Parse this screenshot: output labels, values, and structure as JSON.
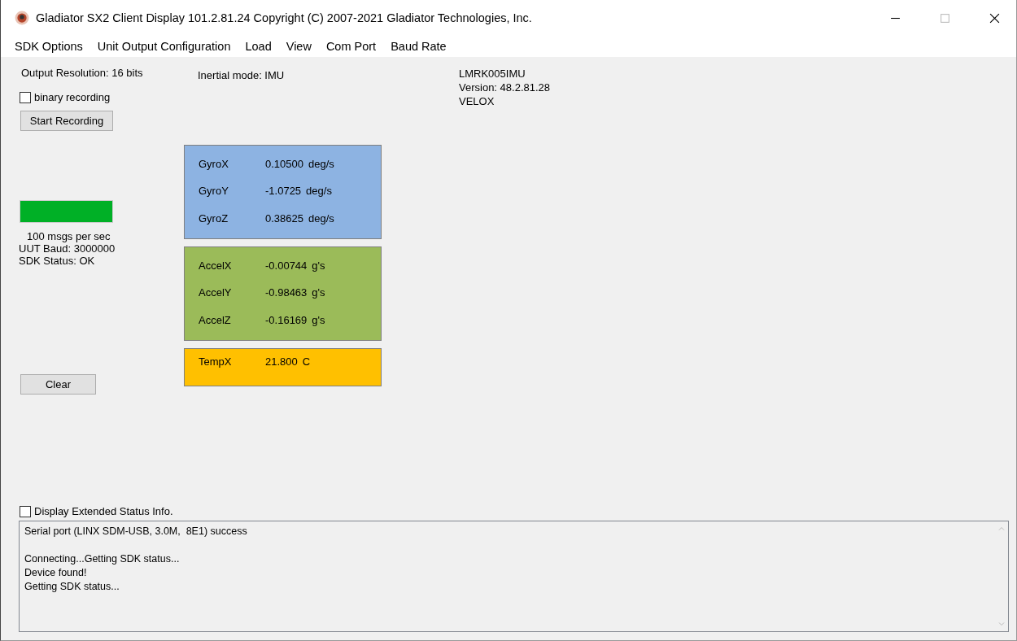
{
  "window": {
    "title": "Gladiator SX2 Client Display 101.2.81.24 Copyright (C) 2007-2021 Gladiator Technologies, Inc."
  },
  "menu": [
    "SDK Options",
    "Unit Output Configuration",
    "Load",
    "View",
    "Com Port",
    "Baud Rate"
  ],
  "output_resolution": "Output Resolution: 16 bits",
  "binary_recording": {
    "label": "binary recording",
    "checked": false
  },
  "start_button": "Start Recording",
  "rate_meter": {
    "level": 1
  },
  "rate": "100  msgs per sec",
  "uut_baud": "UUT Baud: 3000000",
  "sdk_status": "SDK Status: OK",
  "clear_button": "Clear",
  "inertial_mode": "Inertial mode: IMU",
  "device": [
    "LMRK005IMU",
    "Version: 48.2.81.28",
    "VELOX"
  ],
  "panels": [
    {
      "color": "#8db3e2",
      "rows": [
        {
          "label": "GyroX",
          "value": "0.10500",
          "unit": "deg/s"
        },
        {
          "label": "GyroY",
          "value": "-1.0725",
          "unit": "deg/s"
        },
        {
          "label": "GyroZ",
          "value": "0.38625",
          "unit": "deg/s"
        }
      ]
    },
    {
      "color": "#9bbb59",
      "rows": [
        {
          "label": "AccelX",
          "value": "-0.00744",
          "unit": "g's"
        },
        {
          "label": "AccelY",
          "value": "-0.98463",
          "unit": "g's"
        },
        {
          "label": "AccelZ",
          "value": "-0.16169",
          "unit": "g's"
        }
      ]
    },
    {
      "color": "#ffc000",
      "rows": [
        {
          "label": "TempX",
          "value": "21.800",
          "unit": "C"
        }
      ]
    }
  ],
  "extended_status": {
    "label": "Display Extended Status Info.",
    "checked": false
  },
  "log": [
    [
      "Serial port (LINX SDM-USB, 3.0M,  8E1) success"
    ],
    [
      "Connecting...Getting SDK status...",
      "Device found!",
      "Getting SDK status..."
    ]
  ]
}
